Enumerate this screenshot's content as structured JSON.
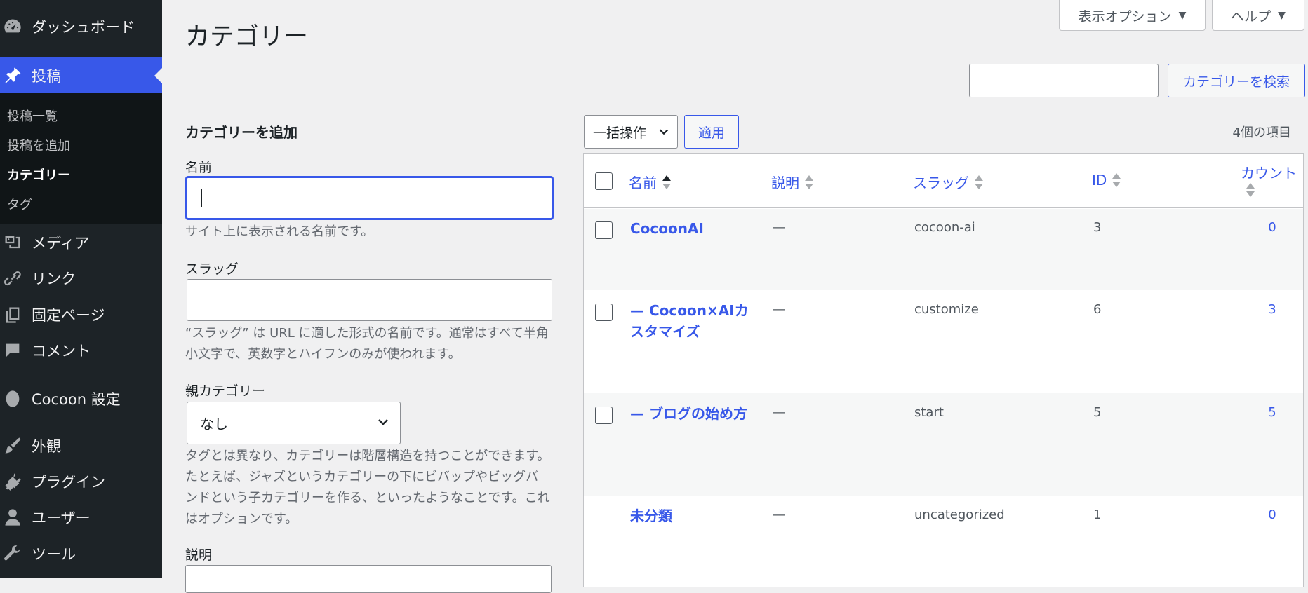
{
  "sidebar": {
    "menu": [
      {
        "label": "ダッシュボード",
        "icon": "dashboard-icon"
      },
      {
        "label": "投稿",
        "icon": "pin-icon"
      },
      {
        "label": "メディア",
        "icon": "media-icon"
      },
      {
        "label": "リンク",
        "icon": "link-icon"
      },
      {
        "label": "固定ページ",
        "icon": "pages-icon"
      },
      {
        "label": "コメント",
        "icon": "comment-icon"
      },
      {
        "label": "Cocoon 設定",
        "icon": "cocoon-icon"
      },
      {
        "label": "外観",
        "icon": "brush-icon"
      },
      {
        "label": "プラグイン",
        "icon": "plugin-icon"
      },
      {
        "label": "ユーザー",
        "icon": "user-icon"
      },
      {
        "label": "ツール",
        "icon": "wrench-icon"
      }
    ],
    "submenu": [
      {
        "label": "投稿一覧"
      },
      {
        "label": "投稿を追加"
      },
      {
        "label": "カテゴリー"
      },
      {
        "label": "タグ"
      }
    ],
    "accent": "#3858e9"
  },
  "header": {
    "screen_options": "表示オプション",
    "help": "ヘルプ",
    "title": "カテゴリー",
    "search_button": "カテゴリーを検索",
    "search_value": ""
  },
  "form": {
    "title": "カテゴリーを追加",
    "name_label": "名前",
    "name_value": "",
    "name_help": "サイト上に表示される名前です。",
    "slug_label": "スラッグ",
    "slug_value": "",
    "slug_help": "“スラッグ” は URL に適した形式の名前です。通常はすべて半角小文字で、英数字とハイフンのみが使われます。",
    "parent_label": "親カテゴリー",
    "parent_value": "なし",
    "parent_help": "タグとは異なり、カテゴリーは階層構造を持つことができます。たとえば、ジャズというカテゴリーの下にビバップやビッグバンドという子カテゴリーを作る、といったようなことです。これはオプションです。",
    "desc_label": "説明"
  },
  "bulk": {
    "select_label": "一括操作",
    "apply": "適用",
    "count": "4個の項目"
  },
  "table": {
    "headers": {
      "name": "名前",
      "desc": "説明",
      "slug": "スラッグ",
      "id": "ID",
      "count": "カウント"
    },
    "rows": [
      {
        "name": "CocoonAI",
        "desc": "—",
        "slug": "cocoon-ai",
        "id": "3",
        "count": "0"
      },
      {
        "name": "— Cocoon×AIカスタマイズ",
        "desc": "—",
        "slug": "customize",
        "id": "6",
        "count": "3"
      },
      {
        "name": "— ブログの始め方",
        "desc": "—",
        "slug": "start",
        "id": "5",
        "count": "5"
      },
      {
        "name": "未分類",
        "desc": "—",
        "slug": "uncategorized",
        "id": "1",
        "count": "0"
      }
    ]
  }
}
